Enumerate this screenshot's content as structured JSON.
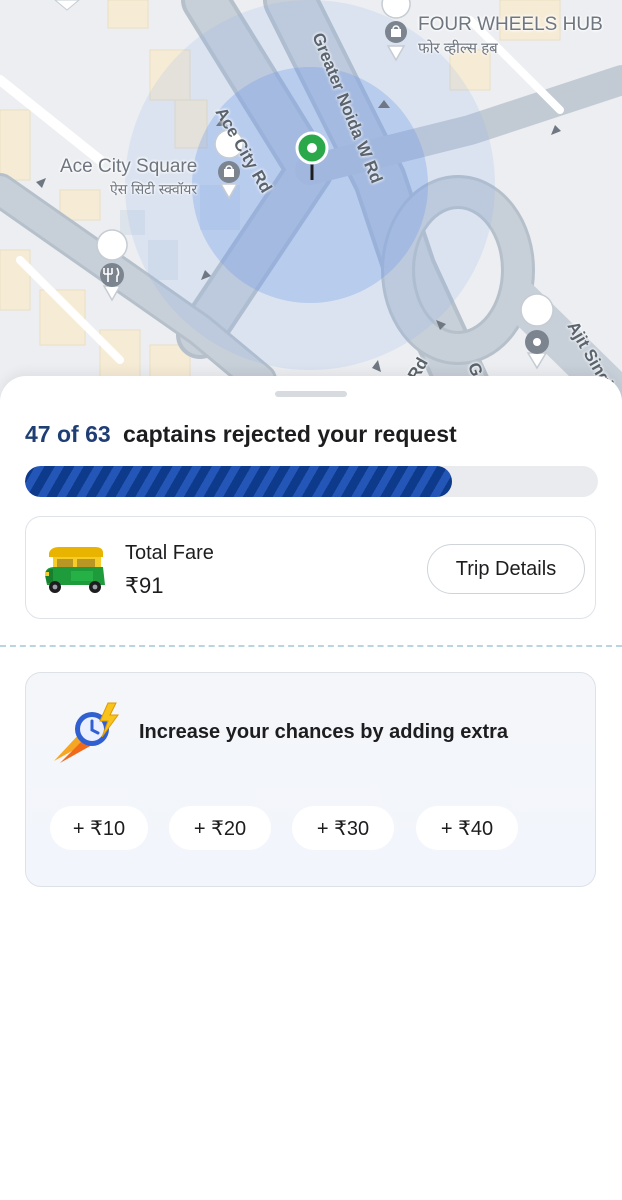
{
  "map": {
    "labels": {
      "four_wheels_hub_en": "FOUR WHEELS HUB",
      "four_wheels_hub_hi": "फोर व्हील्स हब",
      "ace_city_square_en": "Ace City Square",
      "ace_city_square_hi": "ऐस सिटी स्क्वॉयर",
      "ace_city_rd": "Ace City Rd",
      "greater_noida_w_rd": "Greater Noida W Rd",
      "ajit_singh": "Ajit Singh",
      "rd_fragment": "Rd",
      "g_fragment": "G"
    },
    "icons": [
      "shopping-bag-icon",
      "restaurant-icon",
      "location-pin-icon",
      "pickup-pin-icon"
    ],
    "colors": {
      "radius_circle": "#5b8ee6",
      "pickup_pin": "#2aa84a"
    }
  },
  "sheet": {
    "status": {
      "count": "47 of 63",
      "text": "captains rejected your request"
    },
    "progress": {
      "fraction": 0.746,
      "color": "#0d3a8a"
    },
    "fare": {
      "label": "Total Fare",
      "amount": "₹91",
      "vehicle_icon": "auto-rickshaw-icon",
      "trip_details_label": "Trip Details"
    },
    "boost": {
      "icon": "fast-clock-icon",
      "title": "Increase your chances by adding extra",
      "options": [
        {
          "label": "+ ₹10"
        },
        {
          "label": "+ ₹20"
        },
        {
          "label": "+ ₹30"
        },
        {
          "label": "+ ₹40"
        }
      ]
    }
  }
}
